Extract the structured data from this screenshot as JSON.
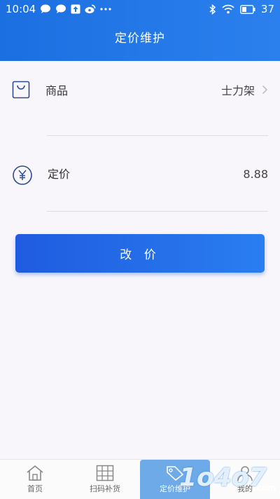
{
  "status_bar": {
    "time": "10:04",
    "battery": "37",
    "icons_left": [
      "chat-icon",
      "chat-icon",
      "upload-icon",
      "weibo-icon",
      "more-dots-icon"
    ],
    "icons_right": [
      "bluetooth-icon",
      "wifi-icon",
      "battery-icon"
    ]
  },
  "header": {
    "title": "定价维护"
  },
  "form": {
    "product": {
      "label": "商品",
      "value": "士力架",
      "icon": "bag-icon"
    },
    "price": {
      "label": "定价",
      "value": "8.88",
      "icon": "yen-icon"
    }
  },
  "actions": {
    "change_price_label": "改 价"
  },
  "tabbar": {
    "tabs": [
      {
        "label": "首页",
        "icon": "home-icon"
      },
      {
        "label": "扫码补货",
        "icon": "grid-icon"
      },
      {
        "label": "定价维护",
        "icon": "tag-icon",
        "active": true
      },
      {
        "label": "我的",
        "icon": "profile-icon"
      }
    ]
  },
  "watermark": {
    "text": "1o4o7",
    "suffix": ".com"
  },
  "colors": {
    "accent": "#1f5be0",
    "header": "#2b80ee",
    "active_tab": "#6ea9e8"
  }
}
